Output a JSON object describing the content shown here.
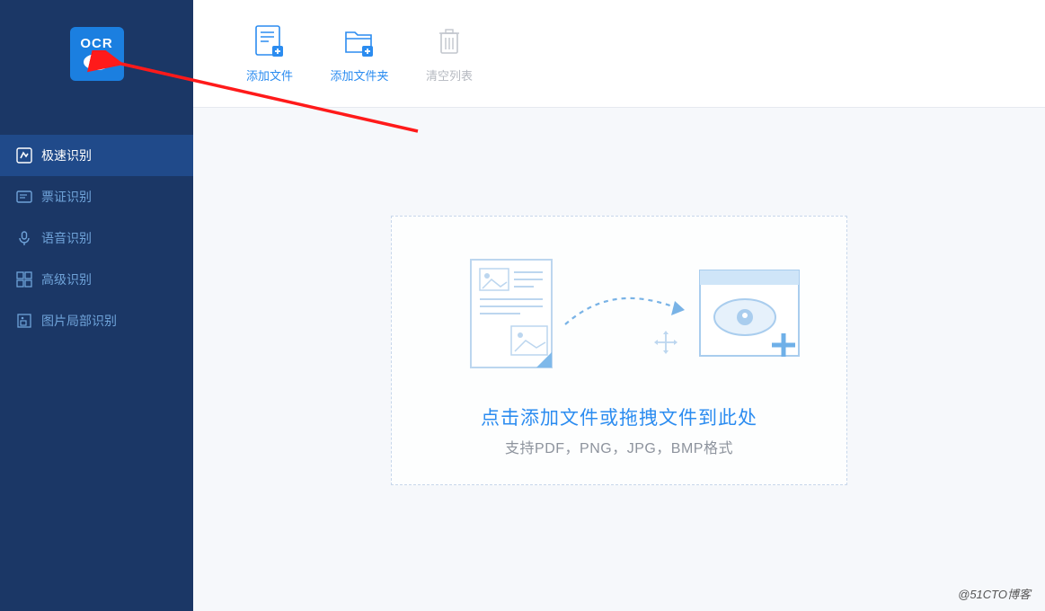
{
  "logo": {
    "text": "OCR"
  },
  "sidebar": {
    "items": [
      {
        "label": "极速识别",
        "active": true,
        "icon": "speed-icon"
      },
      {
        "label": "票证识别",
        "active": false,
        "icon": "ticket-icon"
      },
      {
        "label": "语音识别",
        "active": false,
        "icon": "mic-icon"
      },
      {
        "label": "高级识别",
        "active": false,
        "icon": "advanced-icon"
      },
      {
        "label": "图片局部识别",
        "active": false,
        "icon": "crop-icon"
      }
    ]
  },
  "toolbar": {
    "items": [
      {
        "label": "添加文件",
        "icon": "add-file-icon",
        "enabled": true
      },
      {
        "label": "添加文件夹",
        "icon": "add-folder-icon",
        "enabled": true
      },
      {
        "label": "清空列表",
        "icon": "trash-icon",
        "enabled": false
      }
    ]
  },
  "dropzone": {
    "title": "点击添加文件或拖拽文件到此处",
    "subtitle": "支持PDF，PNG，JPG，BMP格式"
  },
  "watermark": "@51CTO博客",
  "colors": {
    "sidebar_bg": "#1b3766",
    "active_bg": "#204a8a",
    "accent": "#2b8cf0",
    "muted": "#b5b9c0"
  }
}
